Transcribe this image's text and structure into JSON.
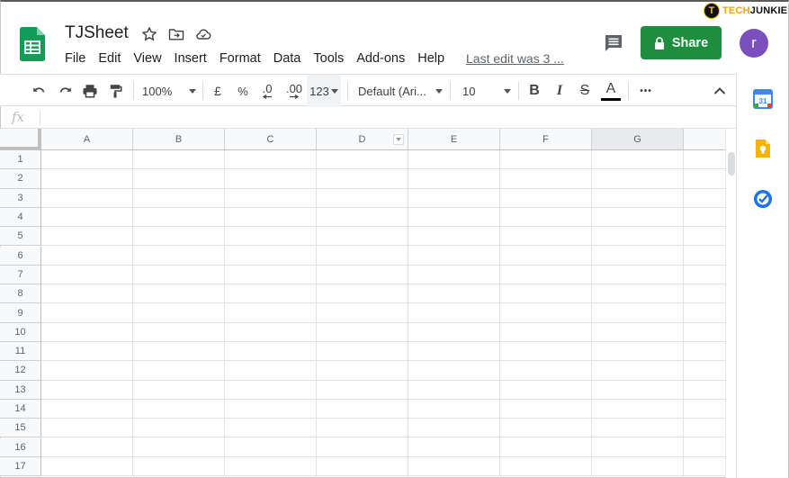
{
  "header": {
    "doc_title": "TJSheet",
    "menu": [
      "File",
      "Edit",
      "View",
      "Insert",
      "Format",
      "Data",
      "Tools",
      "Add-ons",
      "Help"
    ],
    "last_edit": "Last edit was 3 ...",
    "share_label": "Share",
    "avatar_letter": "r"
  },
  "watermark": {
    "part1": "TECH",
    "part2": "JUNKIE",
    "badge": "T"
  },
  "toolbar": {
    "zoom": "100%",
    "currency": "£",
    "percent": "%",
    "decrease_decimal": ".0",
    "increase_decimal": ".00",
    "more_formats": "123",
    "font": "Default (Ari...",
    "font_size": "10",
    "bold": "B",
    "italic": "I",
    "strike": "S",
    "text_color": "A",
    "more": "•••"
  },
  "formula_bar": {
    "fx": "fx"
  },
  "grid": {
    "columns": [
      "A",
      "B",
      "C",
      "D",
      "E",
      "F",
      "G"
    ],
    "rows": [
      "1",
      "2",
      "3",
      "4",
      "5",
      "6",
      "7",
      "8",
      "9",
      "10",
      "11",
      "12",
      "13",
      "14",
      "15",
      "16",
      "17"
    ]
  },
  "colors": {
    "share_green": "#1e8e3e",
    "avatar_purple": "#7b4fbd",
    "sheets_green": "#0f9d58"
  }
}
